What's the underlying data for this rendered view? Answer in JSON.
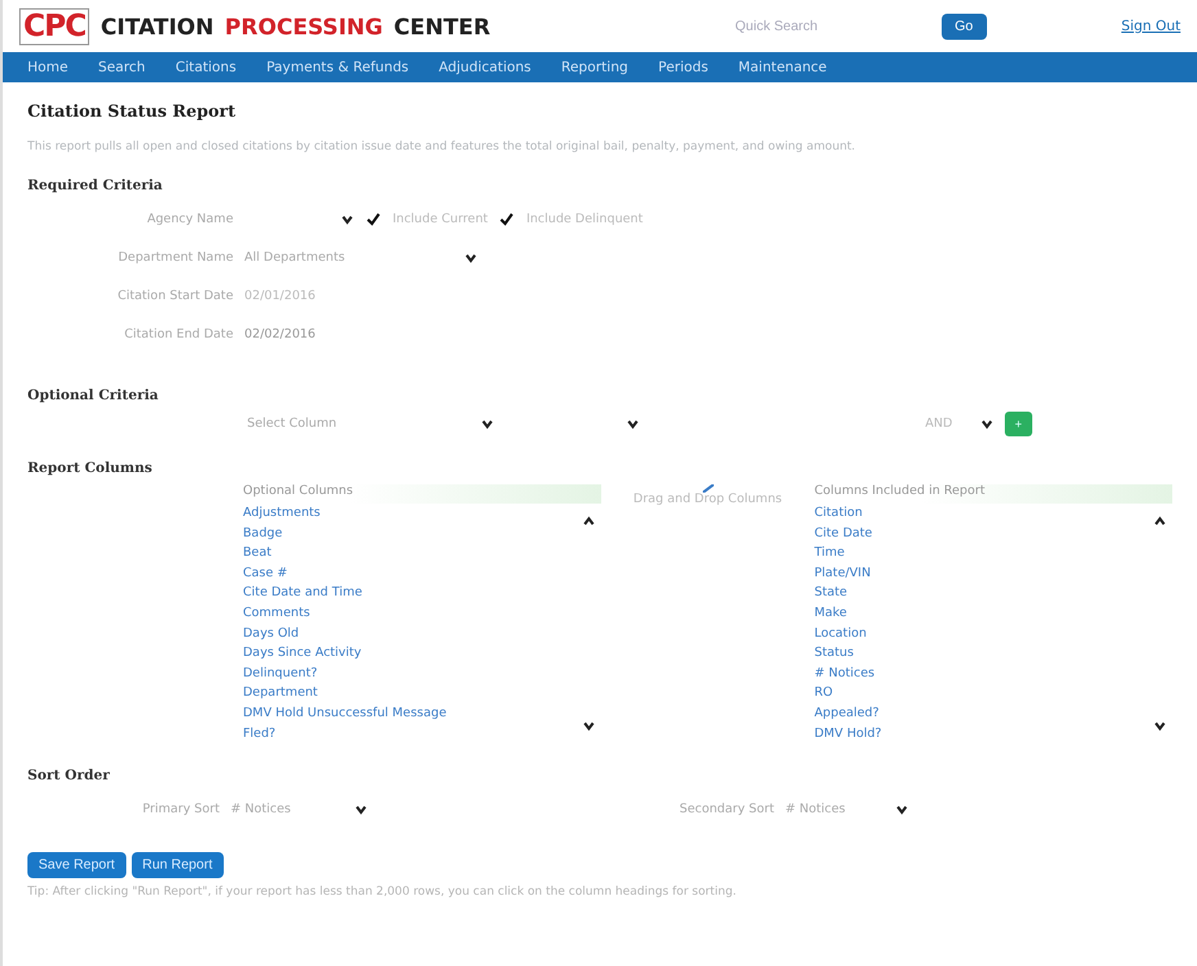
{
  "header": {
    "logo": "CPC",
    "title_parts": [
      "CITATION",
      "PROCESSING",
      "CENTER"
    ],
    "search": {
      "placeholder": "Quick Search"
    },
    "go_button": "Go",
    "sign_out": "Sign Out"
  },
  "nav": [
    "Home",
    "Search",
    "Citations",
    "Payments & Refunds",
    "Adjudications",
    "Reporting",
    "Periods",
    "Maintenance"
  ],
  "page_title": "Citation Status Report",
  "description": "This report pulls all open and closed citations by citation issue date and features the total original bail, penalty, payment, and owing amount.",
  "required": {
    "heading": "Required Criteria",
    "agency": {
      "label": "Agency Name",
      "checks": [
        {
          "label": "Include Current",
          "checked": true
        },
        {
          "label": "Include Delinquent",
          "checked": true
        }
      ]
    },
    "department": {
      "label": "Department Name",
      "value": "All Departments"
    },
    "start": {
      "label": "Citation Start Date",
      "value": "02/01/2016"
    },
    "end": {
      "label": "Citation End Date",
      "value": "02/02/2016"
    }
  },
  "optional": {
    "heading": "Optional Criteria",
    "column_select": "Select Column",
    "conjunction": "AND",
    "add_button": "+"
  },
  "report_columns": {
    "heading": "Report Columns",
    "drag_hint": "Drag and Drop Columns",
    "available": {
      "title": "Optional Columns",
      "items": [
        "Adjustments",
        "Badge",
        "Beat",
        "Case #",
        "Cite Date and Time",
        "Comments",
        "Days Old",
        "Days Since Activity",
        "Delinquent?",
        "Department",
        "DMV Hold Unsuccessful Message",
        "Fled?"
      ]
    },
    "included": {
      "title": "Columns Included in Report",
      "items": [
        "Citation",
        "Cite Date",
        "Time",
        "Plate/VIN",
        "State",
        "Make",
        "Location",
        "Status",
        "# Notices",
        "RO",
        "Appealed?",
        "DMV Hold?"
      ]
    }
  },
  "sort": {
    "heading": "Sort Order",
    "primary": {
      "label": "Primary Sort",
      "value": "# Notices"
    },
    "secondary": {
      "label": "Secondary Sort",
      "value": "# Notices"
    }
  },
  "buttons": [
    "Save Report",
    "Run Report"
  ],
  "tip": "Tip: After clicking \"Run Report\", if your report has less than 2,000 rows, you can click on the column headings for sorting."
}
